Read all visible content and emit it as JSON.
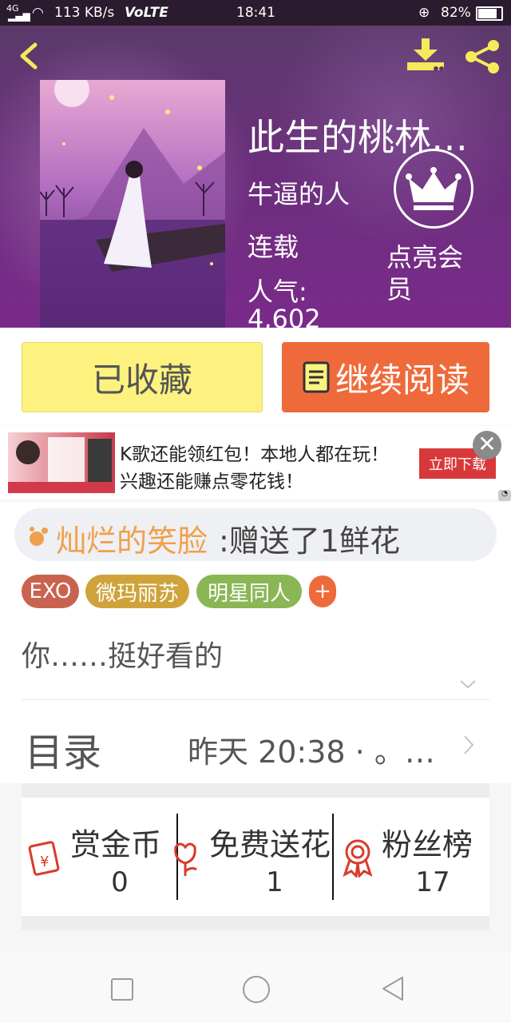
{
  "status_bar": {
    "network": "4G",
    "speed": "113 KB/s",
    "volte": "VoLTE",
    "time": "18:41",
    "battery": "82%"
  },
  "book": {
    "title": "此生的桃林…",
    "author": "牛逼的人",
    "status": "连载",
    "popularity_label": "人气:",
    "popularity_value": "4,602",
    "vip_label": "点亮会员"
  },
  "actions": {
    "collected": "已收藏",
    "continue_reading": "继续阅读"
  },
  "ad": {
    "line1": "K歌还能领红包！本地人都在玩！",
    "line2": "兴趣还能赚点零花钱！",
    "cta": "立即下载"
  },
  "gift_notice": {
    "user": "灿烂的笑脸",
    "message": ":赠送了1鲜花"
  },
  "tags": [
    {
      "label": "EXO",
      "color": "#c9634f"
    },
    {
      "label": "微玛丽苏",
      "color": "#cfa33a"
    },
    {
      "label": "明星同人",
      "color": "#8bb655"
    },
    {
      "label": "+",
      "color": "#ef6a3a"
    }
  ],
  "summary": "你……挺好看的",
  "catalog": {
    "label": "目录",
    "updated": "昨天 20:38 · 。…"
  },
  "stats": [
    {
      "label": "赏金币",
      "value": "0",
      "icon": "red-envelope-icon"
    },
    {
      "label": "免费送花",
      "value": "1",
      "icon": "flower-icon"
    },
    {
      "label": "粉丝榜",
      "value": "17",
      "icon": "medal-icon"
    }
  ],
  "colors": {
    "accent_orange": "#ef6a3a",
    "collect_yellow": "#fdf27f",
    "gift_user": "#f0a04a"
  }
}
